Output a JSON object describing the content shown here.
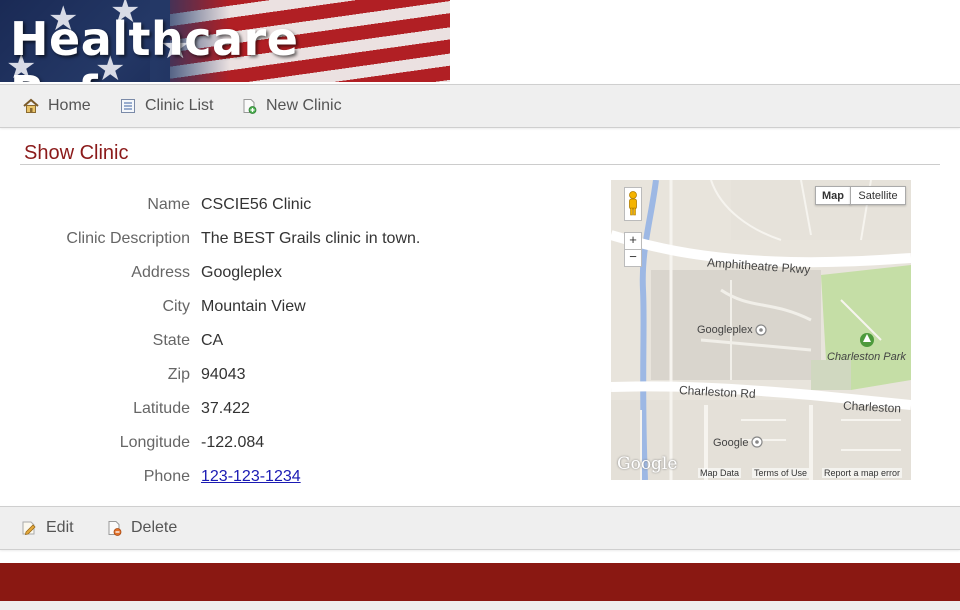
{
  "banner": {
    "title": "Healthcare Reform"
  },
  "nav": {
    "home": "Home",
    "clinic_list": "Clinic List",
    "new_clinic": "New Clinic"
  },
  "page": {
    "heading": "Show Clinic"
  },
  "clinic": {
    "fields": [
      {
        "label": "Name",
        "value": "CSCIE56 Clinic"
      },
      {
        "label": "Clinic Description",
        "value": "The BEST Grails clinic in town."
      },
      {
        "label": "Address",
        "value": "Googleplex"
      },
      {
        "label": "City",
        "value": "Mountain View"
      },
      {
        "label": "State",
        "value": "CA"
      },
      {
        "label": "Zip",
        "value": "94043"
      },
      {
        "label": "Latitude",
        "value": "37.422"
      },
      {
        "label": "Longitude",
        "value": "-122.084"
      },
      {
        "label": "Phone",
        "value": "123-123-1234"
      }
    ]
  },
  "map": {
    "type_map": "Map",
    "type_satellite": "Satellite",
    "zoom_in": "+",
    "zoom_out": "−",
    "labels": {
      "amphitheatre": "Amphitheatre Pkwy",
      "googleplex": "Googleplex",
      "charleston_park": "Charleston Park",
      "charleston_rd": "Charleston Rd",
      "charleston_right": "Charleston",
      "google": "Google"
    },
    "logo": "Google",
    "footer": {
      "map_data": "Map Data",
      "terms": "Terms of Use",
      "report": "Report a map error"
    }
  },
  "actions": {
    "edit": "Edit",
    "delete": "Delete"
  },
  "colors": {
    "heading": "#8b1a1a",
    "footer": "#8a1812",
    "link": "#1a1ab3"
  },
  "icons": {
    "home": "home-icon",
    "clinic_list": "list-icon",
    "new_clinic": "new-document-icon",
    "edit": "edit-icon",
    "delete": "delete-icon",
    "pegman": "pegman-icon"
  }
}
